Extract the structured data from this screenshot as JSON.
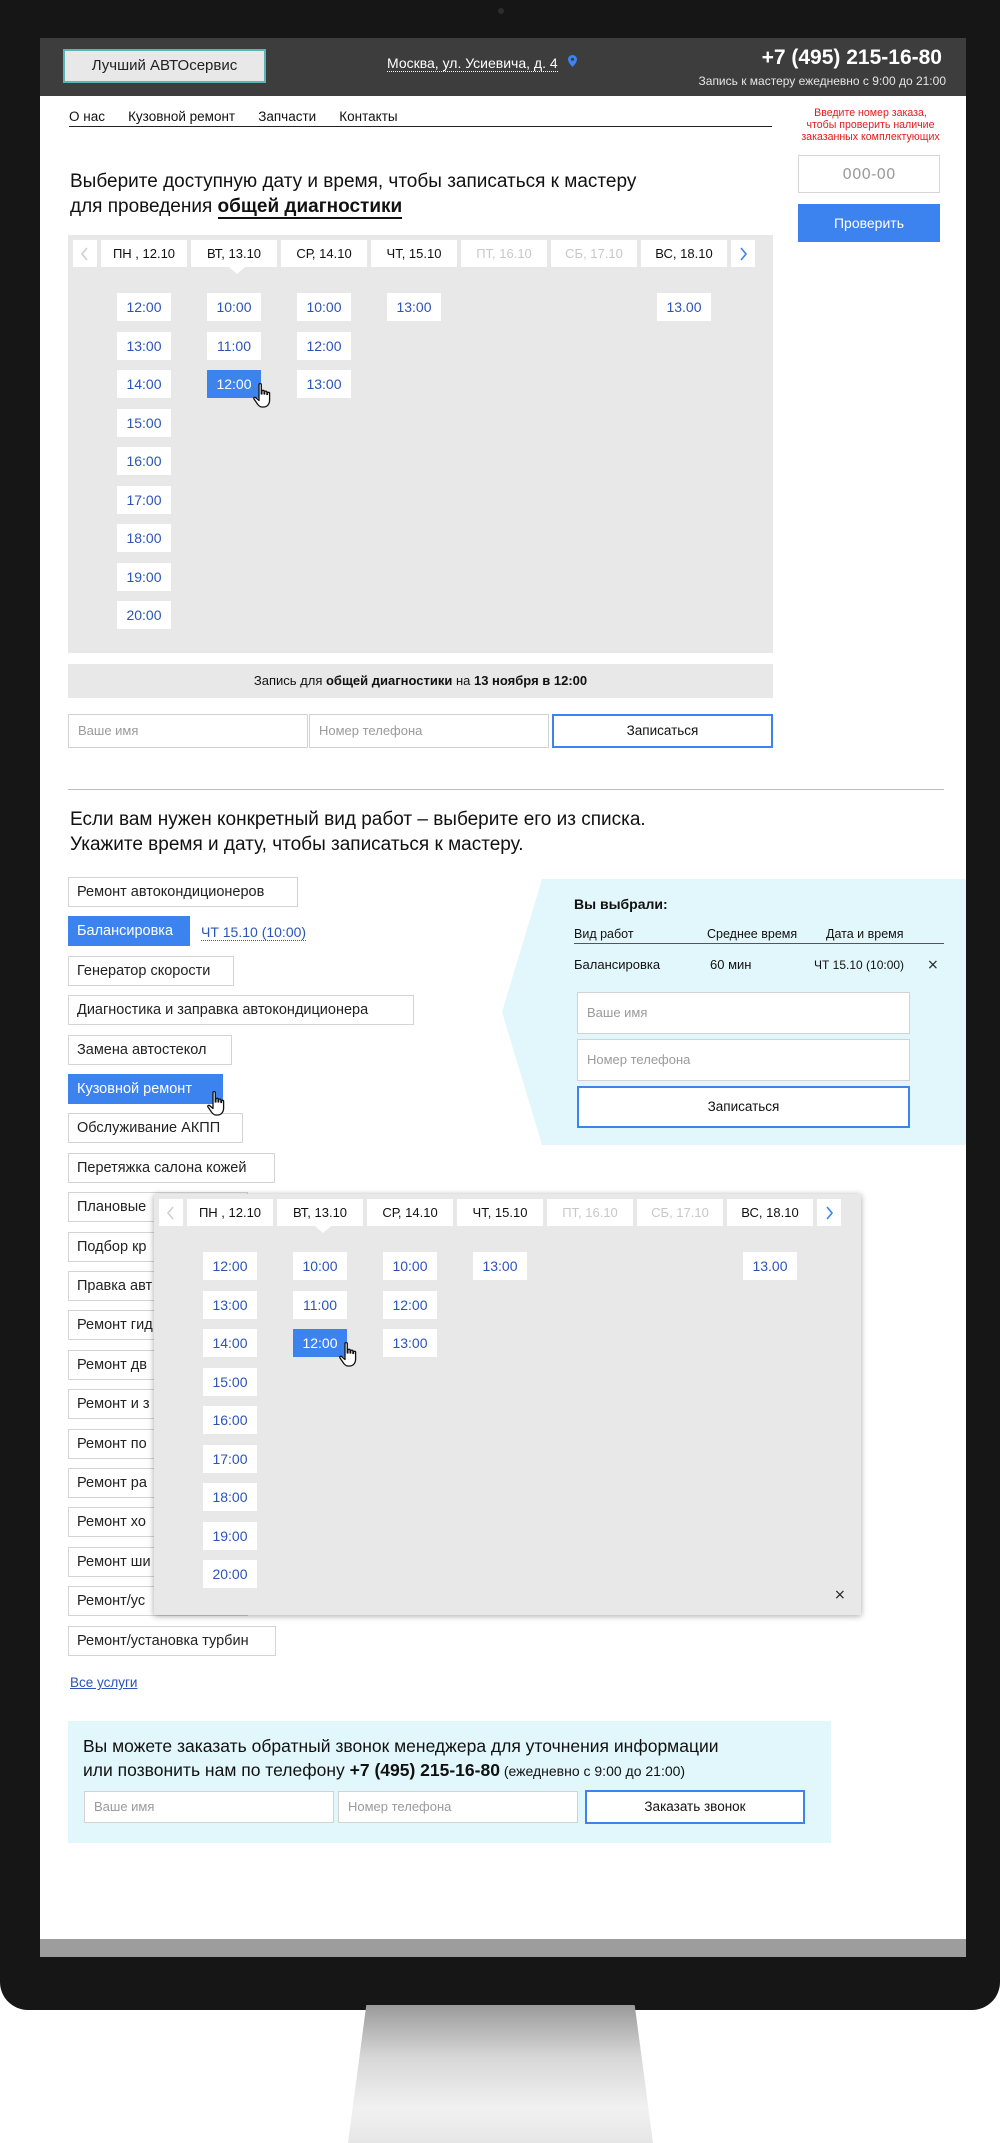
{
  "header": {
    "logo": "Лучший АВТОсервис",
    "address": "Москва, ул. Усиевича, д. 4",
    "phone": "+7 (495) 215-16-80",
    "phone_note": "Запись к мастеру ежедневно с 9:00 до 21:00"
  },
  "nav": [
    "О нас",
    "Кузовной ремонт",
    "Запчасти",
    "Контакты"
  ],
  "order_check": {
    "hint": "Введите номер заказа, чтобы проверить наличие заказанных комплектующих",
    "placeholder": "000-00",
    "button": "Проверить"
  },
  "diagnostics": {
    "headline_1": "Выберите доступную дату и время, чтобы записаться к мастеру",
    "headline_2_plain": "для проведения ",
    "headline_2_bold": "общей диагностики",
    "summary": {
      "prefix": "Запись для ",
      "service": "общей диагностики",
      "mid": " на ",
      "datetime": "13 ноября в 12:00"
    },
    "name_placeholder": "Ваше имя",
    "phone_placeholder": "Номер телефона",
    "submit": "Записаться"
  },
  "schedule": {
    "days": [
      {
        "label": "ПН , 12.10",
        "disabled": false
      },
      {
        "label": "ВТ, 13.10",
        "disabled": false
      },
      {
        "label": "СР, 14.10",
        "disabled": false
      },
      {
        "label": "ЧТ, 15.10",
        "disabled": false
      },
      {
        "label": "ПТ, 16.10",
        "disabled": true
      },
      {
        "label": "СБ, 17.10",
        "disabled": true
      },
      {
        "label": "ВС, 18.10",
        "disabled": false
      }
    ],
    "slots": [
      [
        "12:00",
        "13:00",
        "14:00",
        "15:00",
        "16:00",
        "17:00",
        "18:00",
        "19:00",
        "20:00"
      ],
      [
        "10:00",
        "11:00",
        "12:00"
      ],
      [
        "10:00",
        "12:00",
        "13:00"
      ],
      [
        "13:00"
      ],
      [],
      [],
      [
        "13.00"
      ]
    ],
    "selected_day": 1,
    "selected_slot": "12:00"
  },
  "services_section": {
    "headline_1": "Если вам нужен конкретный вид работ – выберите его из списка.",
    "headline_2": "Укажите  время и дату, чтобы записаться к мастеру.",
    "items": [
      "Ремонт автокондиционеров",
      "Балансировка",
      "Генератор скорости",
      "Диагностика и заправка автокондиционера",
      "Замена автостекол",
      "Кузовной ремонт",
      "Обслуживание АКПП",
      "Перетяжка салона кожей",
      "Плановые",
      "Подбор кр",
      "Правка авт",
      "Ремонт гид",
      "Ремонт дв",
      "Ремонт и з",
      "Ремонт по",
      "Ремонт ра",
      "Ремонт хо",
      "Ремонт ши",
      "Ремонт/ус",
      "Ремонт/установка турбин"
    ],
    "active_items": [
      1,
      5
    ],
    "balancing_date": "ЧТ 15.10  (10:00)",
    "all_services": "Все услуги"
  },
  "picked": {
    "title": "Вы выбрали:",
    "col_work": "Вид работ",
    "col_time": "Среднее время",
    "col_date": "Дата и время",
    "work": "Балансировка",
    "avg_time": "60 мин",
    "date": "ЧТ 15.10 (10:00)",
    "remove": "×",
    "name_placeholder": "Ваше имя",
    "phone_placeholder": "Номер телефона",
    "submit": "Записаться"
  },
  "popup": {
    "close": "×"
  },
  "callback": {
    "line_1": "Вы можете заказать обратный звонок менеджера для уточнения информации",
    "line_2_plain": "или позвонить нам по телефону ",
    "line_2_phone": "+7 (495) 215-16-80",
    "line_2_hours": " (ежедневно с 9:00 до 21:00)",
    "name_placeholder": "Ваше имя",
    "phone_placeholder": "Номер телефона",
    "submit": "Заказать звонок"
  },
  "colors": {
    "accent": "#3c83ef",
    "link": "#2b54b8",
    "header": "#3d3d3d",
    "panel": "#e8e8e8",
    "highlight": "#e2f7fb",
    "hint": "#e21b1b"
  },
  "icons": [
    "location-pin-icon",
    "chevron-left-icon",
    "chevron-right-icon",
    "hand-cursor-icon",
    "close-icon"
  ]
}
